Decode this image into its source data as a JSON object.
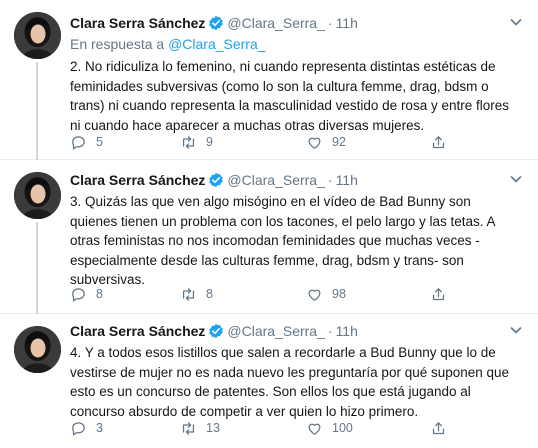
{
  "colors": {
    "accent": "#1da1f2",
    "muted": "#657786",
    "text": "#14171a",
    "border": "#e6ecf0"
  },
  "icons": {
    "reply": "reply-icon",
    "retweet": "retweet-icon",
    "like": "heart-icon",
    "share": "share-icon",
    "verified": "verified-badge-icon",
    "more": "chevron-down-icon"
  },
  "tweets": [
    {
      "name": "Clara Serra Sánchez",
      "handle": "@Clara_Serra_",
      "dot": "·",
      "time": "11h",
      "reply_prefix": "En respuesta a ",
      "reply_handle": "@Clara_Serra_",
      "text": "2. No ridiculiza lo femenino, ni cuando representa distintas estéticas de\nfeminidades subversivas (como lo son la cultura femme, drag, bdsm o\ntrans) ni cuando representa la masculinidad vestido de rosa y entre flores\nni cuando hace aparecer a muchas otras diversas mujeres.",
      "replies": "5",
      "retweets": "9",
      "likes": "92"
    },
    {
      "name": "Clara Serra Sánchez",
      "handle": "@Clara_Serra_",
      "dot": "·",
      "time": "11h",
      "text": "3. Quizás las que ven algo misógino en el vídeo de Bad Bunny son\nquienes tienen un problema con los tacones, el pelo largo y las tetas. A\notras feministas no nos incomodan feminidades que muchas veces -\nespecialmente desde las culturas femme, drag, bdsm y trans- son\nsubversivas.",
      "replies": "8",
      "retweets": "8",
      "likes": "98"
    },
    {
      "name": "Clara Serra Sánchez",
      "handle": "@Clara_Serra_",
      "dot": "·",
      "time": "11h",
      "text": "4. Y a todos esos listillos que salen a recordarle a Bud Bunny que lo de\nvestirse de mujer no es nada nuevo les preguntaría por qué suponen que\nesto es un concurso de patentes. Son ellos los que está jugando al\nconcurso absurdo de competir a ver quien lo hizo primero.",
      "replies": "3",
      "retweets": "13",
      "likes": "100"
    }
  ]
}
